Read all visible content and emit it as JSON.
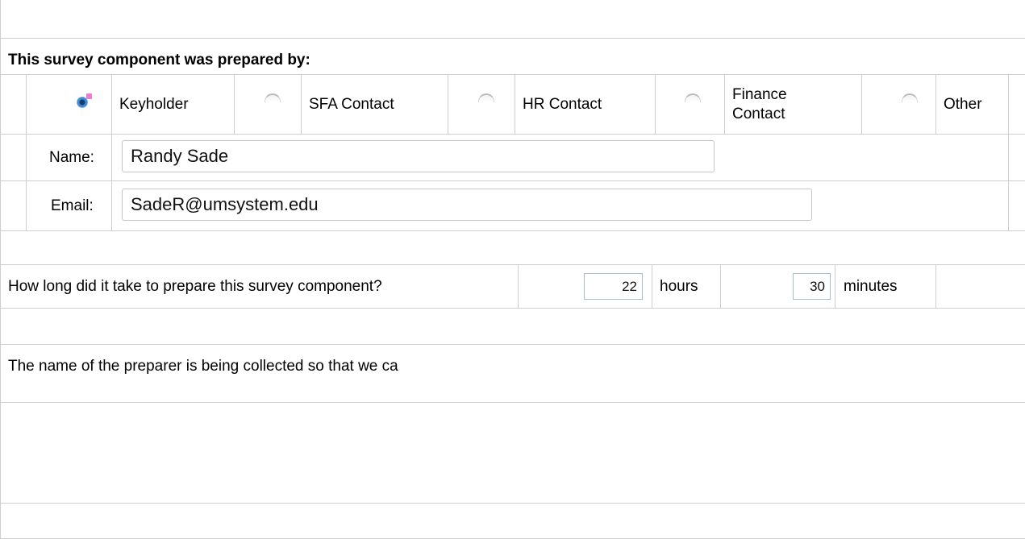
{
  "section": {
    "title": "This survey component was prepared by:"
  },
  "roles": [
    {
      "label": "Keyholder",
      "selected": true
    },
    {
      "label": "SFA Contact",
      "selected": false
    },
    {
      "label": "HR Contact",
      "selected": false
    },
    {
      "label": "Finance Contact",
      "selected": false
    },
    {
      "label": "Other",
      "selected": false
    }
  ],
  "preparer": {
    "name_label": "Name:",
    "name_value": "Randy Sade",
    "email_label": "Email:",
    "email_value": "SadeR@umsystem.edu"
  },
  "time": {
    "question": "How long did it take to prepare this survey component?",
    "hours_value": "22",
    "hours_label": "hours",
    "minutes_value": "30",
    "minutes_label": "minutes"
  },
  "note": {
    "text": "The name of the preparer is being collected so that we ca"
  }
}
